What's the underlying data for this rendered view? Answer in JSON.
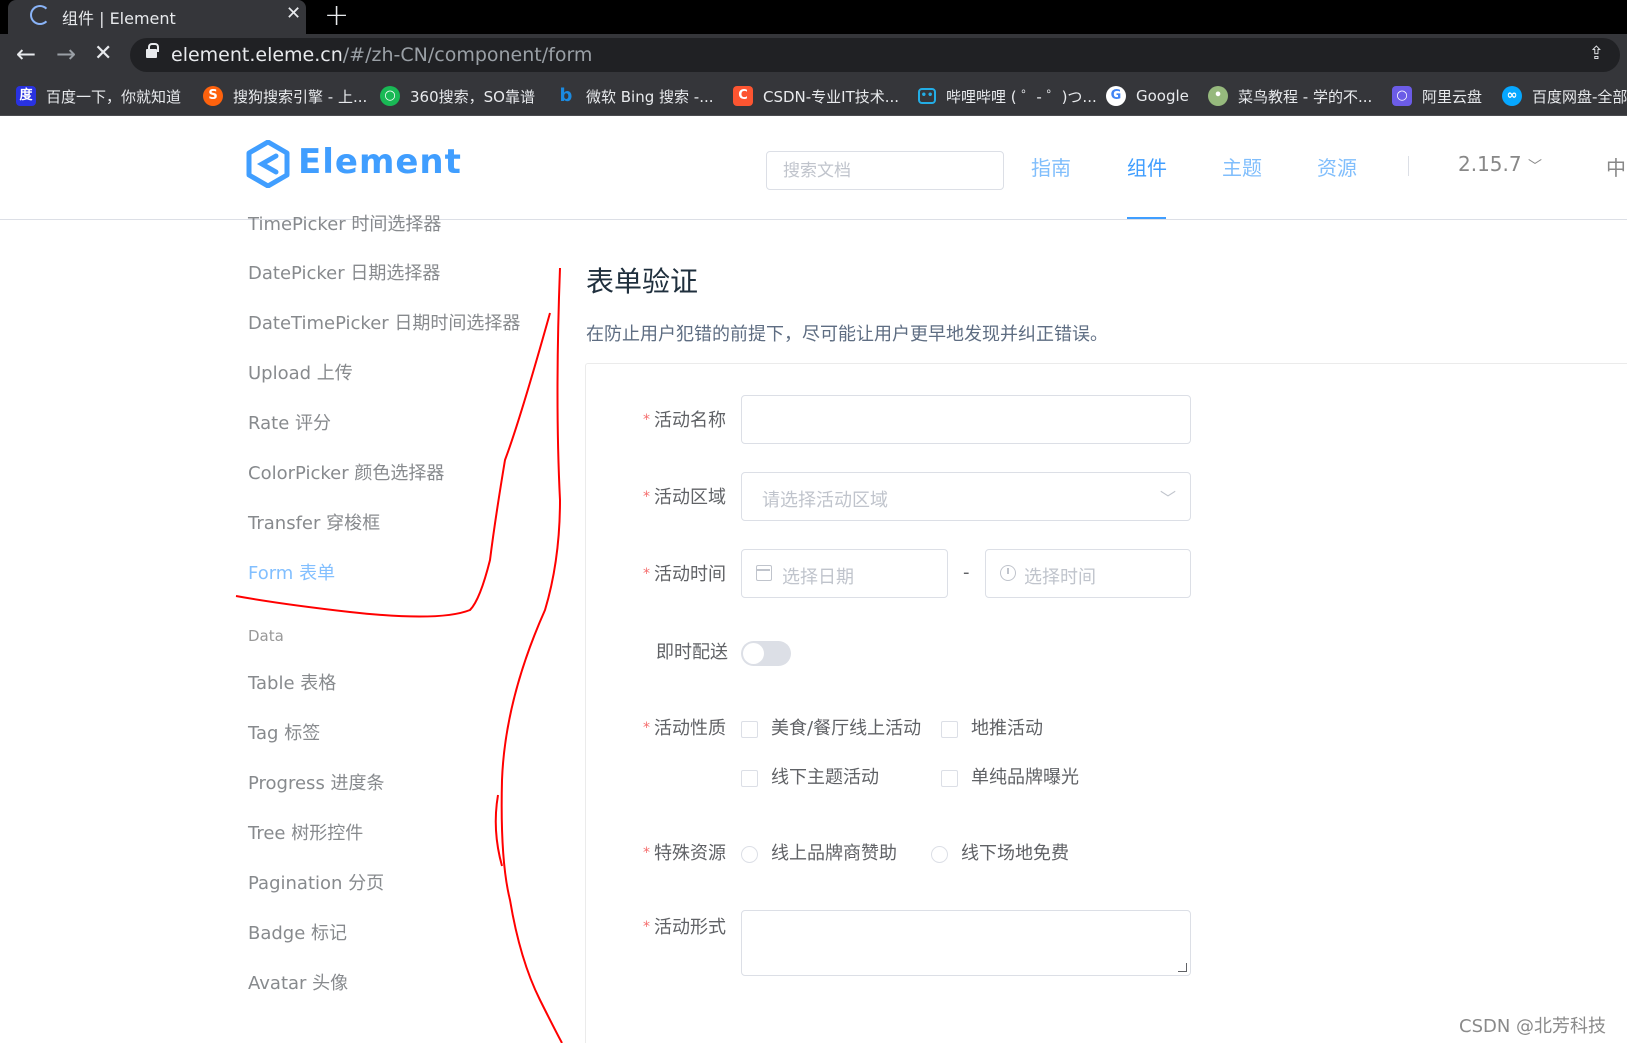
{
  "browser": {
    "tab_title": "组件 | Element",
    "url_host": "element.eleme.cn",
    "url_path": "/#/zh-CN/component/form",
    "bookmarks": [
      {
        "label": "百度一下，你就知道",
        "icon": "baidu-icon",
        "color": "#2932e1"
      },
      {
        "label": "搜狗搜索引擎 - 上...",
        "icon": "sogou-icon",
        "color": "#fe620d"
      },
      {
        "label": "360搜索，SO靠谱",
        "icon": "so360-icon",
        "color": "#19b955"
      },
      {
        "label": "微软 Bing 搜索 -...",
        "icon": "bing-icon",
        "color": "#1b8ae0"
      },
      {
        "label": "CSDN-专业IT技术...",
        "icon": "csdn-icon",
        "color": "#fc5531"
      },
      {
        "label": "哔哩哔哩 ( ゜- ゜)つ...",
        "icon": "bilibili-icon",
        "color": "#23ade5"
      },
      {
        "label": "Google",
        "icon": "google-icon",
        "color": "#4285f4"
      },
      {
        "label": "菜鸟教程 - 学的不...",
        "icon": "runoob-icon",
        "color": "#96b97d"
      },
      {
        "label": "阿里云盘",
        "icon": "aliyun-drive-icon",
        "color": "#6c5ce7"
      },
      {
        "label": "百度网盘-全部",
        "icon": "baidu-pan-icon",
        "color": "#06a7ff"
      }
    ]
  },
  "header": {
    "logo_text": "Element",
    "search_placeholder": "搜索文档",
    "nav": [
      "指南",
      "组件",
      "主题",
      "资源"
    ],
    "active_nav": "组件",
    "version": "2.15.7",
    "lang": "中"
  },
  "sidebar": {
    "items_top": [
      "TimePicker 时间选择器",
      "DatePicker 日期选择器",
      "DateTimePicker 日期时间选择器",
      "Upload 上传",
      "Rate 评分",
      "ColorPicker 颜色选择器",
      "Transfer 穿梭框",
      "Form 表单"
    ],
    "active_item": "Form 表单",
    "group_label": "Data",
    "items_data": [
      "Table 表格",
      "Tag 标签",
      "Progress 进度条",
      "Tree 树形控件",
      "Pagination 分页",
      "Badge 标记",
      "Avatar 头像"
    ]
  },
  "main": {
    "title": "表单验证",
    "description": "在防止用户犯错的前提下，尽可能让用户更早地发现并纠正错误。",
    "form": {
      "required_mark": "*",
      "name_label": "活动名称",
      "name_value": "",
      "region_label": "活动区域",
      "region_placeholder": "请选择活动区域",
      "time_label": "活动时间",
      "date_placeholder": "选择日期",
      "time_separator": "-",
      "time_placeholder": "选择时间",
      "delivery_label": "即时配送",
      "delivery_on": false,
      "type_label": "活动性质",
      "type_options": [
        "美食/餐厅线上活动",
        "地推活动",
        "线下主题活动",
        "单纯品牌曝光"
      ],
      "resource_label": "特殊资源",
      "resource_options": [
        "线上品牌商赞助",
        "线下场地免费"
      ],
      "desc_label": "活动形式",
      "desc_value": ""
    }
  },
  "watermark": "CSDN @北芳科技",
  "colors": {
    "primary": "#409eff",
    "annotation": "#ff0000",
    "required": "#f56c6c"
  }
}
